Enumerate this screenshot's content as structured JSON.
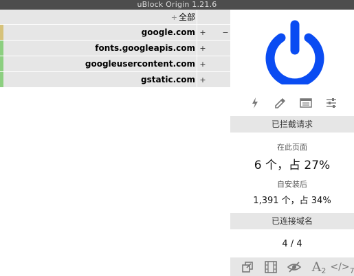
{
  "window": {
    "title": "uBlock Origin 1.21.6"
  },
  "firewall": {
    "all_row": {
      "prefix": "+",
      "label": "全部"
    },
    "rows": [
      {
        "host": "google.com",
        "plus": "+",
        "minus": "−",
        "indicator_color": "#d6c27a"
      },
      {
        "host": "fonts.googleapis.com",
        "plus": "+",
        "indicator_color": "#8ccf80"
      },
      {
        "host": "googleusercontent.com",
        "plus": "+",
        "indicator_color": "#8ccf80"
      },
      {
        "host": "gstatic.com",
        "plus": "+",
        "indicator_color": "#8ccf80"
      }
    ]
  },
  "panel": {
    "power_color": "#0a4cf2",
    "tool_icons": [
      "lightning-icon",
      "eyedropper-icon",
      "logger-icon",
      "settings-icon"
    ],
    "blocked_header": "已拦截请求",
    "on_page_label": "在此页面",
    "on_page_value": "6 个，占 27%",
    "since_install_label": "自安装后",
    "since_install_value": "1,391 个，占 34%",
    "domains_header": "已连接域名",
    "domains_value": "4 / 4",
    "bottom_icons": [
      "popup-block-icon",
      "media-block-icon",
      "cosmetic-filter-icon",
      "font-block-icon",
      "script-block-icon"
    ],
    "font_badge": "2",
    "script_badge": "7"
  }
}
